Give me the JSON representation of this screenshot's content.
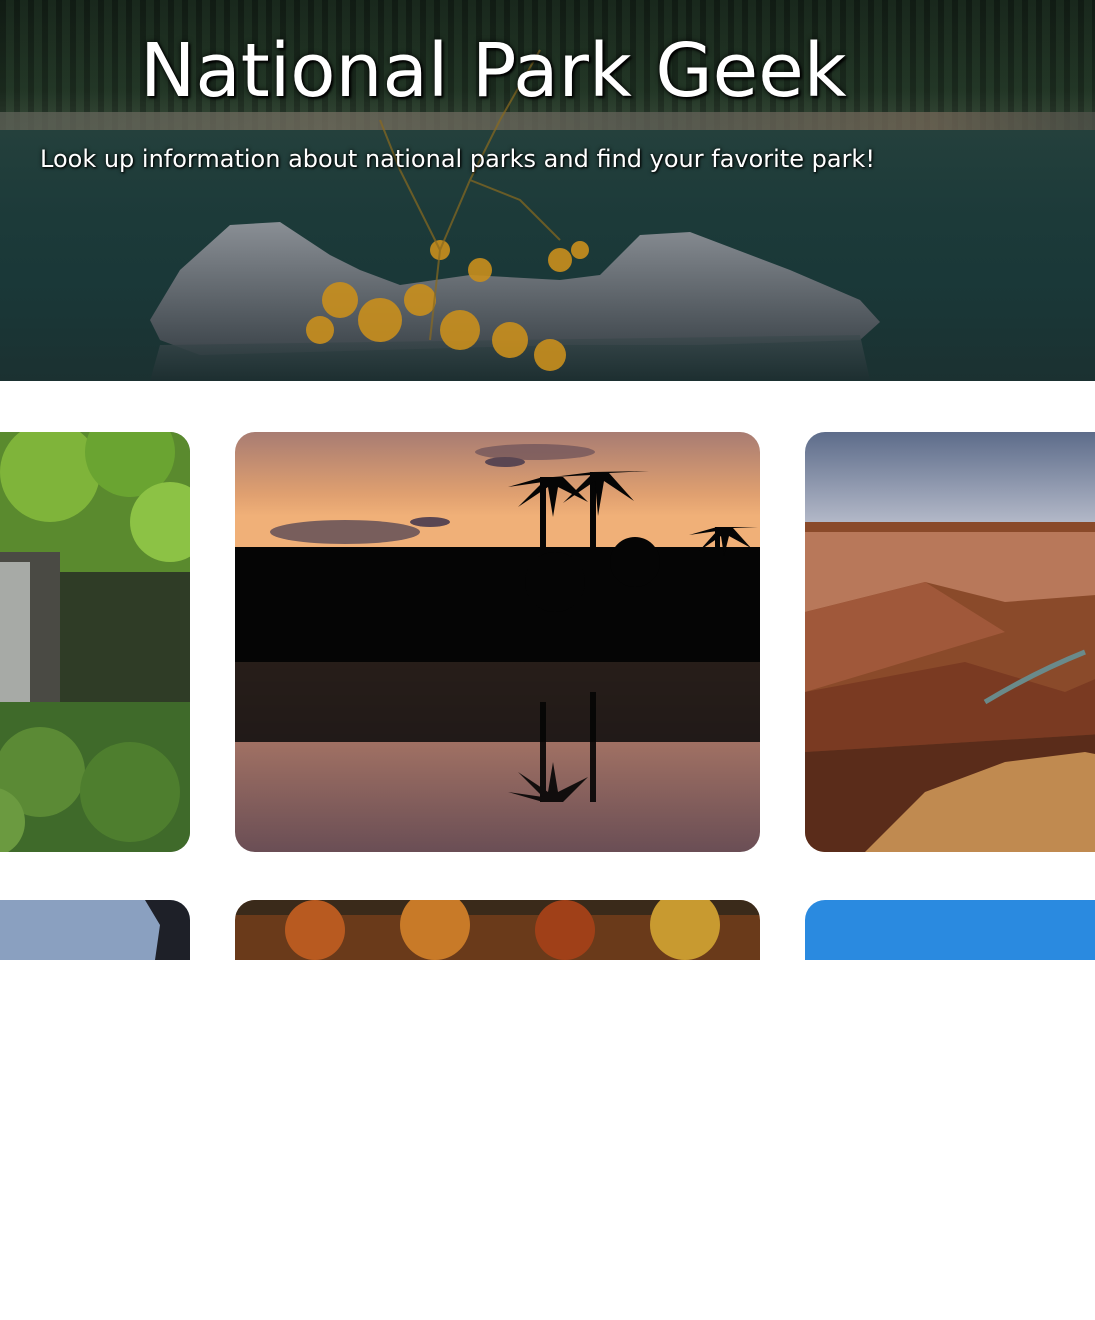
{
  "header": {
    "title": "National Park Geek",
    "subtitle": "Look up information about national parks and find your favorite park!"
  },
  "park_cards": [
    {
      "scene": "waterfall-forest"
    },
    {
      "scene": "palm-sunset-reflection"
    },
    {
      "scene": "canyon"
    },
    {
      "scene": "cliff-sky"
    },
    {
      "scene": "autumn-trees"
    },
    {
      "scene": "blue-sky"
    }
  ],
  "colors": {
    "title_text": "#ffffff",
    "page_background": "#ffffff"
  }
}
